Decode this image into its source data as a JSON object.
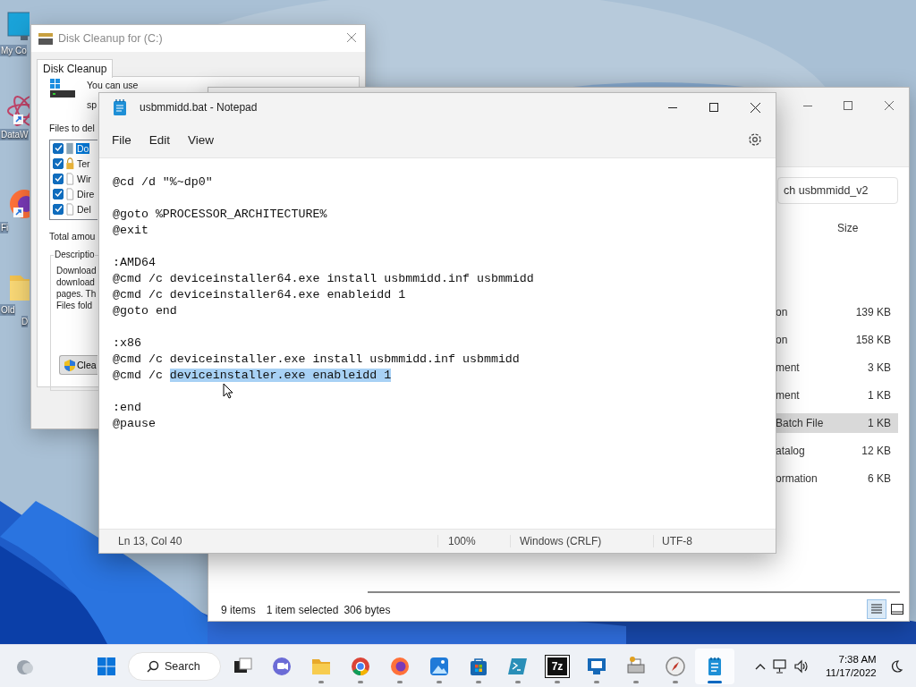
{
  "desktop_icons": [
    {
      "kind": "monitor",
      "lines": [
        "My Co"
      ],
      "shortcut": false
    },
    {
      "kind": "atom",
      "lines": [
        "DataW"
      ],
      "shortcut": true
    },
    {
      "kind": "firefox",
      "lines": [
        "Fi"
      ],
      "shortcut": true
    },
    {
      "kind": "folder",
      "lines": [
        "Old",
        "D"
      ],
      "shortcut": false
    }
  ],
  "disk_cleanup": {
    "title": "Disk Cleanup for  (C:)",
    "tab": "Disk Cleanup",
    "intro_lines": [
      "You can use",
      "sp"
    ],
    "files_label": "Files to del",
    "files": [
      {
        "label": "Do",
        "checked": true,
        "selected": true,
        "kind": "download"
      },
      {
        "label": "Ter",
        "checked": true,
        "selected": false,
        "kind": "lock"
      },
      {
        "label": "Wir",
        "checked": true,
        "selected": false,
        "kind": "page"
      },
      {
        "label": "Dire",
        "checked": true,
        "selected": false,
        "kind": "page"
      },
      {
        "label": "Del",
        "checked": true,
        "selected": false,
        "kind": "page"
      }
    ],
    "total_label": "Total amou",
    "description_title": "Descriptio",
    "description_lines": [
      "Download",
      "download",
      "pages. Th",
      "Files fold"
    ],
    "button": "Clea"
  },
  "explorer": {
    "search": {
      "placeholder": "ch usbmmidd_v2"
    },
    "size_header": "Size",
    "rows": [
      {
        "type": "on",
        "size": "139 KB",
        "selected": false
      },
      {
        "type": "on",
        "size": "158 KB",
        "selected": false
      },
      {
        "type": "ment",
        "size": "3 KB",
        "selected": false
      },
      {
        "type": "ment",
        "size": "1 KB",
        "selected": false
      },
      {
        "type": "Batch File",
        "size": "1 KB",
        "selected": true
      },
      {
        "type": "atalog",
        "size": "12 KB",
        "selected": false
      },
      {
        "type": "ormation",
        "size": "6 KB",
        "selected": false
      }
    ],
    "status": {
      "count": "9 items",
      "selection": "1 item selected",
      "bytes": "306 bytes"
    },
    "views": [
      {
        "kind": "details",
        "selected": true
      },
      {
        "kind": "tiles",
        "selected": false
      }
    ]
  },
  "notepad": {
    "title": "usbmmidd.bat - Notepad",
    "menu": [
      "File",
      "Edit",
      "View"
    ],
    "blocks": [
      [
        {
          "text": "@cd /d \"%~dp0\""
        }
      ],
      [
        {
          "text": "@goto %PROCESSOR_ARCHITECTURE%"
        },
        {
          "text": "@exit"
        }
      ],
      [
        {
          "text": ":AMD64"
        },
        {
          "text": "@cmd /c deviceinstaller64.exe install usbmmidd.inf usbmmidd"
        },
        {
          "text": "@cmd /c deviceinstaller64.exe enableidd 1"
        },
        {
          "text": "@goto end"
        }
      ],
      [
        {
          "text": ":x86"
        },
        {
          "text": "@cmd /c deviceinstaller.exe install usbmmidd.inf usbmmidd"
        },
        {
          "text": "@cmd /c ",
          "selection": "deviceinstaller.exe enableidd 1"
        }
      ],
      [
        {
          "text": ":end"
        },
        {
          "text": "@pause"
        }
      ]
    ],
    "status": [
      "Ln 13, Col 40",
      "100%",
      "Windows (CRLF)",
      "UTF-8"
    ]
  },
  "taskbar": {
    "search": "Search",
    "apps": [
      {
        "kind": "taskview",
        "running": false,
        "selected": false
      },
      {
        "kind": "chat",
        "running": false,
        "selected": false
      },
      {
        "kind": "folder",
        "running": true,
        "selected": false
      },
      {
        "kind": "chrome",
        "running": true,
        "selected": false
      },
      {
        "kind": "firefox",
        "running": true,
        "selected": false
      },
      {
        "kind": "photos",
        "running": true,
        "selected": false
      },
      {
        "kind": "store",
        "running": true,
        "selected": false
      },
      {
        "kind": "terminal",
        "running": true,
        "selected": false
      },
      {
        "kind": "sevenzip",
        "label": "7z",
        "running": true,
        "selected": false
      },
      {
        "kind": "remote",
        "running": true,
        "selected": false
      },
      {
        "kind": "printer",
        "running": true,
        "selected": false
      },
      {
        "kind": "compass",
        "running": true,
        "selected": false
      },
      {
        "kind": "notepad",
        "running": true,
        "selected": true
      }
    ],
    "clock": {
      "time": "7:38 AM",
      "date": "11/17/2022"
    }
  }
}
